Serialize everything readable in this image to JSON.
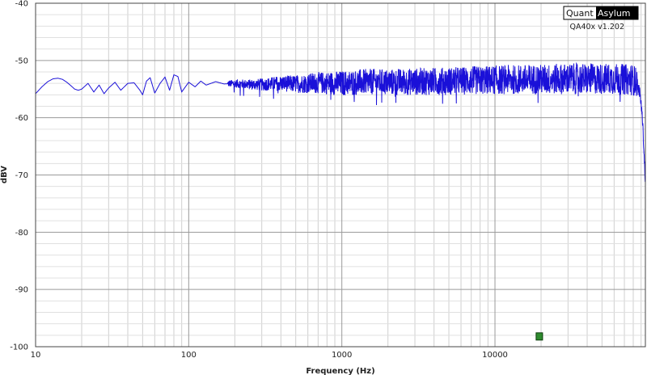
{
  "chart_data": {
    "type": "line",
    "xlabel": "Frequency (Hz)",
    "ylabel": "dBV",
    "x_scale": "log",
    "xlim": [
      10,
      96000
    ],
    "ylim": [
      -100,
      -40
    ],
    "y_ticks": [
      -40,
      -50,
      -60,
      -70,
      -80,
      -90,
      -100
    ],
    "x_ticks": [
      10,
      100,
      1000,
      10000
    ],
    "grid": true,
    "series": [
      {
        "color": "#1a10d8",
        "x": [
          10,
          11,
          12,
          13,
          14,
          15,
          16,
          17,
          18,
          19,
          20,
          22,
          24,
          26,
          28,
          30,
          33,
          36,
          40,
          44,
          48,
          50,
          53,
          56,
          60,
          65,
          70,
          75,
          80,
          85,
          90,
          100,
          110,
          120,
          130,
          150,
          170,
          200,
          250,
          300,
          400,
          500,
          700,
          1000,
          1500,
          2000,
          3000,
          5000,
          7000,
          10000,
          15000,
          20000,
          30000,
          40000,
          50000,
          60000,
          70000,
          80000,
          85000,
          88000,
          90000,
          92000,
          94000,
          96000
        ],
        "y": [
          -55.8,
          -54.6,
          -53.7,
          -53.2,
          -53.1,
          -53.3,
          -53.8,
          -54.4,
          -55.0,
          -55.2,
          -55.0,
          -54.0,
          -55.5,
          -54.3,
          -55.8,
          -54.8,
          -53.8,
          -55.2,
          -54.0,
          -53.9,
          -55.2,
          -56.0,
          -53.6,
          -53.0,
          -55.7,
          -54.0,
          -52.9,
          -55.2,
          -52.5,
          -52.8,
          -55.5,
          -53.8,
          -54.6,
          -53.6,
          -54.3,
          -53.7,
          -54.1,
          -54.0,
          -54.2,
          -54.2,
          -54.0,
          -54.1,
          -53.9,
          -54.0,
          -53.7,
          -53.8,
          -53.7,
          -53.6,
          -53.5,
          -53.4,
          -53.3,
          -53.3,
          -53.2,
          -53.2,
          -53.2,
          -53.2,
          -53.3,
          -53.4,
          -54.0,
          -55.5,
          -57.5,
          -60.5,
          -66.0,
          -71.5
        ]
      }
    ],
    "marker": {
      "x": 19500,
      "y": -98.2,
      "color": "#2e8b2e"
    }
  },
  "logo": {
    "part1": "Quant",
    "part2": "Asylum",
    "version": "QA40x v1.202"
  }
}
